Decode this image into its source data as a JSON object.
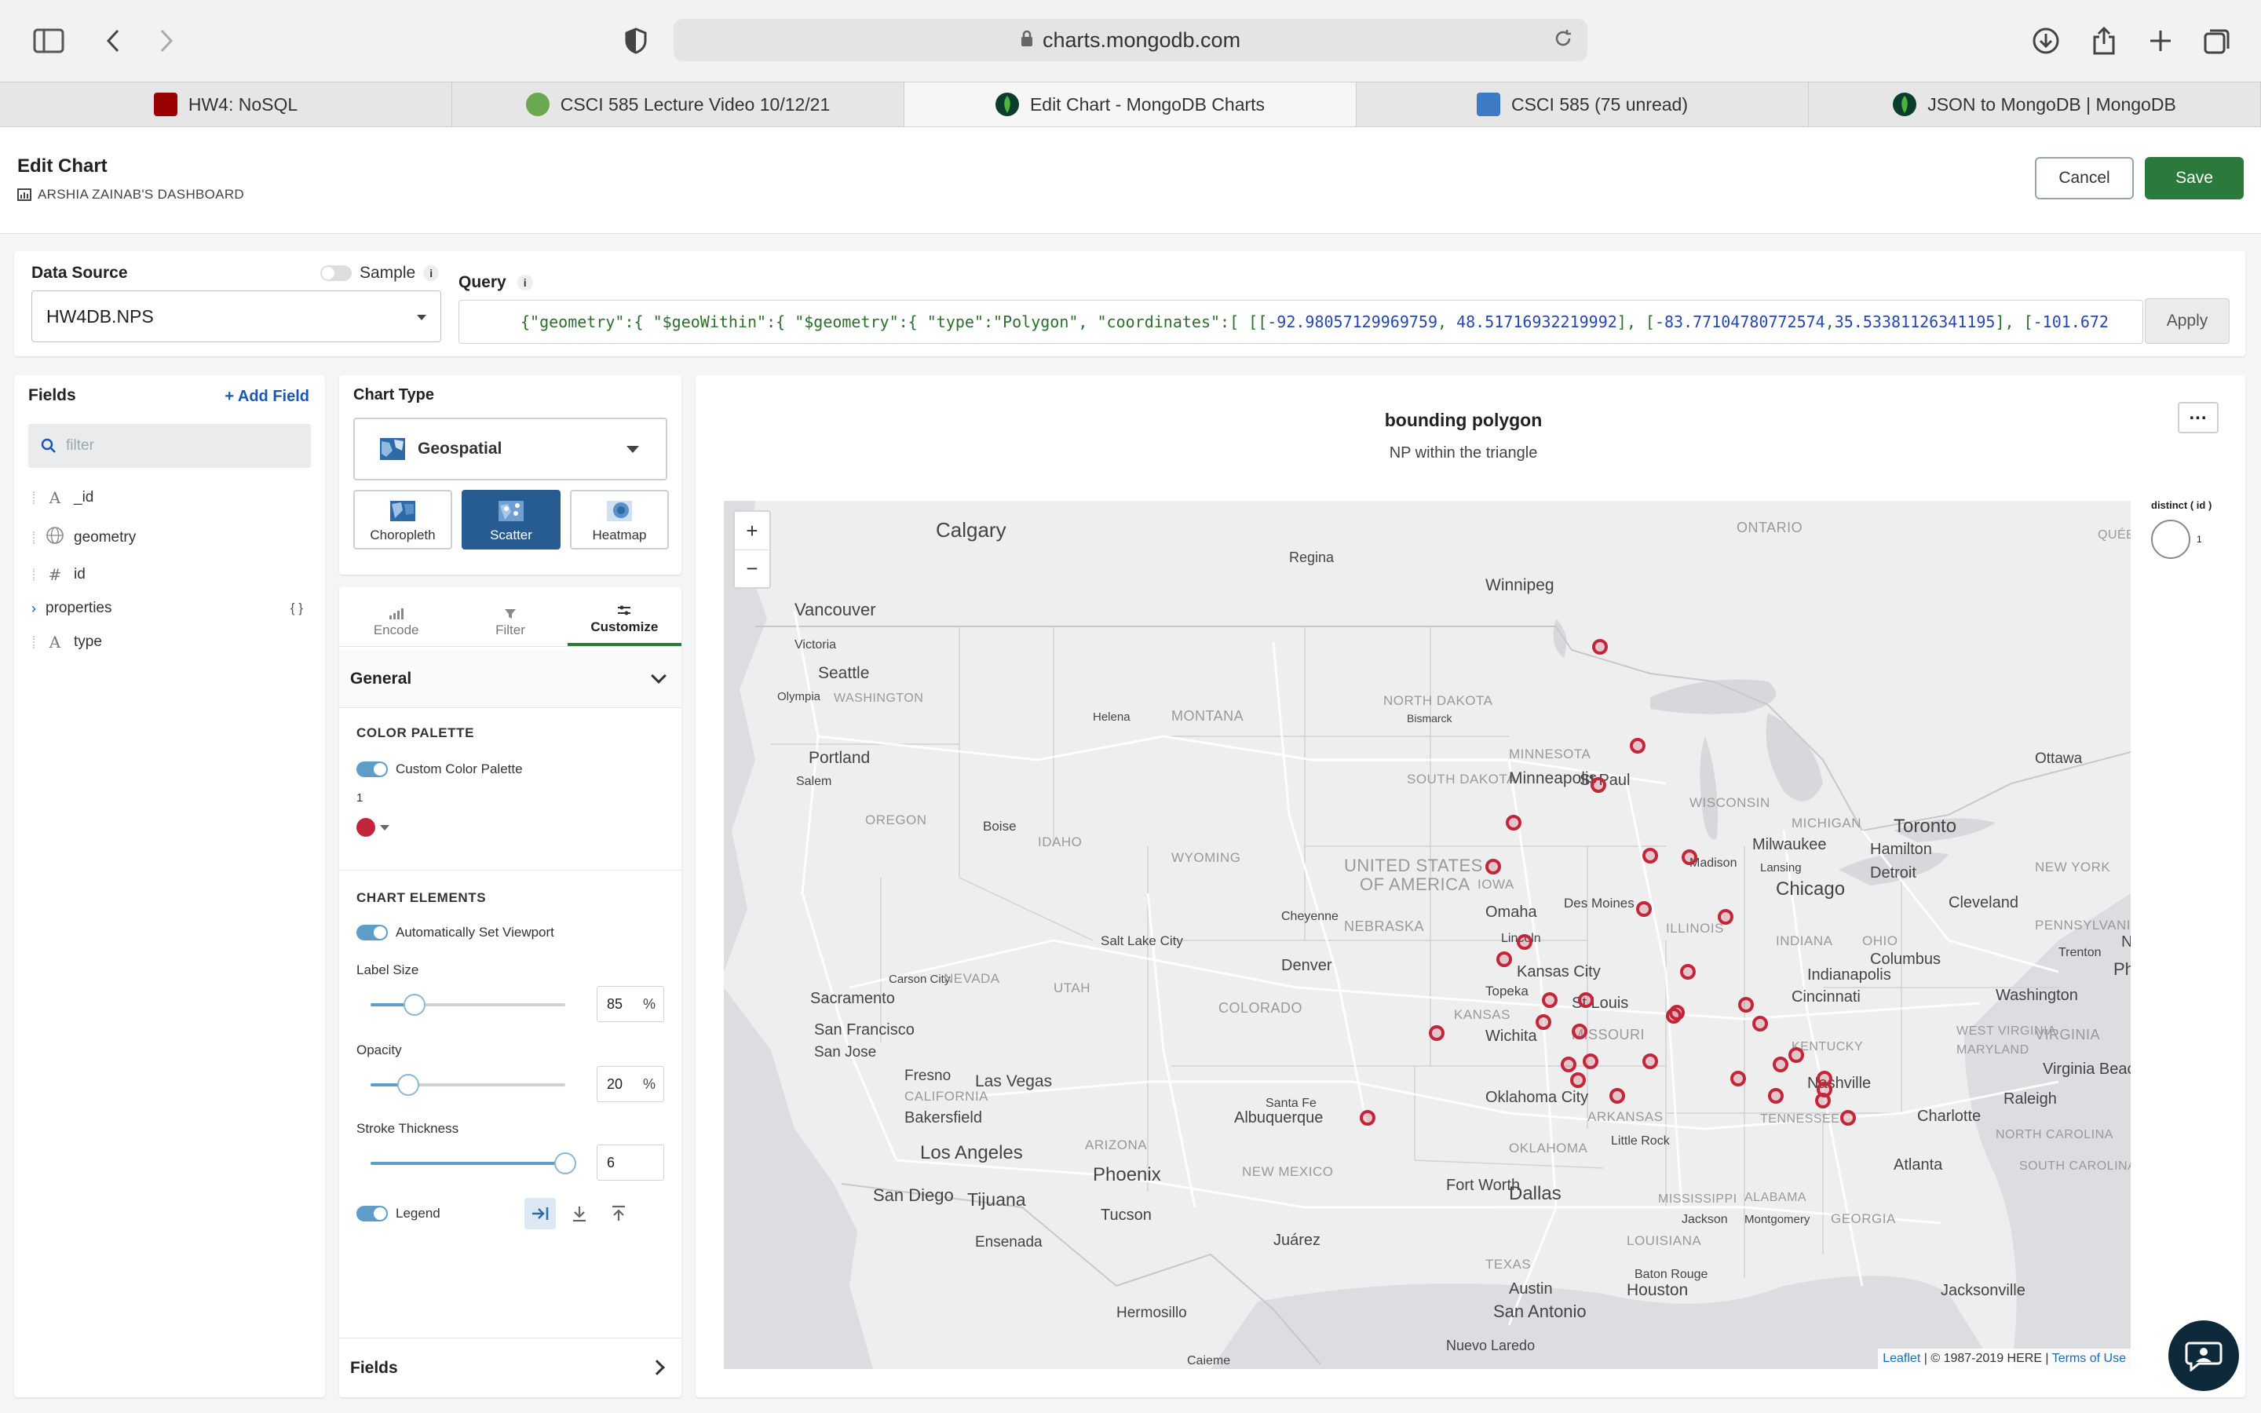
{
  "browser": {
    "url": "charts.mongodb.com",
    "tabs": [
      {
        "label": "HW4: NoSQL",
        "icon": "usc-icon"
      },
      {
        "label": "CSCI 585 Lecture Video 10/12/21",
        "icon": "video-icon"
      },
      {
        "label": "Edit Chart - MongoDB Charts",
        "icon": "mongodb-leaf-icon"
      },
      {
        "label": "CSCI 585 (75 unread)",
        "icon": "piazza-icon"
      },
      {
        "label": "JSON to MongoDB | MongoDB",
        "icon": "mongodb-leaf-icon"
      }
    ]
  },
  "header": {
    "title": "Edit Chart",
    "dashboard": "ARSHIA ZAINAB'S DASHBOARD",
    "cancel": "Cancel",
    "save": "Save"
  },
  "datasource": {
    "label": "Data Source",
    "sample_label": "Sample",
    "value": "HW4DB.NPS",
    "query_label": "Query",
    "query_text_1": "{\"geometry\":{ \"$geoWithin\":{ \"$geometry\":{ \"type\":\"Polygon\", \"coordinates\":[ [[",
    "query_num_1": "-92.98057129969759",
    "query_sep_1": ", ",
    "query_num_2": "48.51716932219992",
    "query_text_2": "], [",
    "query_num_3": "-83.77104780772574",
    "query_sep_2": ",",
    "query_num_4": "35.53381126341195",
    "query_text_3": "], [",
    "query_num_5": "-101.672",
    "apply": "Apply"
  },
  "fields": {
    "title": "Fields",
    "add": "Add Field",
    "filter_placeholder": "filter",
    "items": [
      {
        "type": "A",
        "name": "_id"
      },
      {
        "type": "geo",
        "name": "geometry"
      },
      {
        "type": "#",
        "name": "id"
      },
      {
        "type": "obj",
        "name": "properties",
        "badge": "{ }"
      },
      {
        "type": "A",
        "name": "type"
      }
    ]
  },
  "chart_type": {
    "title": "Chart Type",
    "selected": "Geospatial",
    "subtypes": [
      "Choropleth",
      "Scatter",
      "Heatmap"
    ],
    "active_subtype": "Scatter"
  },
  "customize": {
    "tabs": [
      "Encode",
      "Filter",
      "Customize"
    ],
    "active_tab": "Customize",
    "section": "General",
    "color_palette_label": "COLOR PALETTE",
    "custom_palette_label": "Custom Color Palette",
    "palette_index": "1",
    "palette_color": "#c3263a",
    "chart_elements_label": "CHART ELEMENTS",
    "auto_viewport_label": "Automatically Set Viewport",
    "label_size_label": "Label Size",
    "label_size": "85",
    "opacity_label": "Opacity",
    "opacity": "20",
    "stroke_label": "Stroke Thickness",
    "stroke": "6",
    "legend_label": "Legend",
    "pct": "%",
    "fields_footer": "Fields"
  },
  "chart": {
    "title": "bounding polygon",
    "subtitle": "NP within the triangle",
    "legend_title": "distinct ( id )",
    "legend_value": "1",
    "marker_color": "#c3263a",
    "attribution_link1": "Leaflet",
    "attribution_text": "| © 1987-2019 HERE |",
    "attribution_link2": "Terms of Use",
    "zoom_in": "+",
    "zoom_out": "−"
  },
  "map_labels": [
    {
      "t": "Calgary"
    },
    {
      "t": "Regina"
    },
    {
      "t": "Winnipeg"
    },
    {
      "t": "ONTARIO"
    },
    {
      "t": "QUÉBE"
    },
    {
      "t": "Vancouver"
    },
    {
      "t": "Victoria"
    },
    {
      "t": "Seattle"
    },
    {
      "t": "Olympia"
    },
    {
      "t": "WASHINGTON"
    },
    {
      "t": "Helena"
    },
    {
      "t": "MONTANA"
    },
    {
      "t": "NORTH DAKOTA"
    },
    {
      "t": "Bismarck"
    },
    {
      "t": "MINNESOTA"
    },
    {
      "t": "Portland"
    },
    {
      "t": "Salem"
    },
    {
      "t": "OREGON"
    },
    {
      "t": "Boise"
    },
    {
      "t": "IDAHO"
    },
    {
      "t": "SOUTH DAKOTA"
    },
    {
      "t": "Minneapolis"
    },
    {
      "t": "St Paul"
    },
    {
      "t": "WISCONSIN"
    },
    {
      "t": "MICHIGAN"
    },
    {
      "t": "Toronto"
    },
    {
      "t": "Ottawa"
    },
    {
      "t": "Hamilton"
    },
    {
      "t": "Milwaukee"
    },
    {
      "t": "Madison"
    },
    {
      "t": "Lansing"
    },
    {
      "t": "Detroit"
    },
    {
      "t": "NEW YORK"
    },
    {
      "t": "WYOMING"
    },
    {
      "t": "UNITED STATES"
    },
    {
      "t": "OF AMERICA"
    },
    {
      "t": "IOWA"
    },
    {
      "t": "Des Moines"
    },
    {
      "t": "Chicago"
    },
    {
      "t": "Cleveland"
    },
    {
      "t": "PENNSYLVANIA"
    },
    {
      "t": "NEBRASKA"
    },
    {
      "t": "Omaha"
    },
    {
      "t": "Cheyenne"
    },
    {
      "t": "Lincoln"
    },
    {
      "t": "INDIANA"
    },
    {
      "t": "OHIO"
    },
    {
      "t": "Columbus"
    },
    {
      "t": "Trenton"
    },
    {
      "t": "Phila"
    },
    {
      "t": "Salt Lake City"
    },
    {
      "t": "Denver"
    },
    {
      "t": "Kansas City"
    },
    {
      "t": "ILLINOIS"
    },
    {
      "t": "Indianapolis"
    },
    {
      "t": "Ne"
    },
    {
      "t": "Carson City"
    },
    {
      "t": "NEVADA"
    },
    {
      "t": "Sacramento"
    },
    {
      "t": "UTAH"
    },
    {
      "t": "COLORADO"
    },
    {
      "t": "Topeka"
    },
    {
      "t": "St Louis"
    },
    {
      "t": "Cincinnati"
    },
    {
      "t": "Washington"
    },
    {
      "t": "San Francisco"
    },
    {
      "t": "San Jose"
    },
    {
      "t": "KANSAS"
    },
    {
      "t": "Wichita"
    },
    {
      "t": "MISSOURI"
    },
    {
      "t": "KENTUCKY"
    },
    {
      "t": "WEST VIRGINIA"
    },
    {
      "t": "MARYLAND"
    },
    {
      "t": "VIRGINIA"
    },
    {
      "t": "Virginia Beach"
    },
    {
      "t": "Fresno"
    },
    {
      "t": "CALIFORNIA"
    },
    {
      "t": "Las Vegas"
    },
    {
      "t": "Santa Fe"
    },
    {
      "t": "Oklahoma City"
    },
    {
      "t": "Nashville"
    },
    {
      "t": "Raleigh"
    },
    {
      "t": "Bakersfield"
    },
    {
      "t": "Albuquerque"
    },
    {
      "t": "ARKANSAS"
    },
    {
      "t": "TENNESSEE"
    },
    {
      "t": "Charlotte"
    },
    {
      "t": "NORTH CAROLINA"
    },
    {
      "t": "Los Angeles"
    },
    {
      "t": "ARIZONA"
    },
    {
      "t": "OKLAHOMA"
    },
    {
      "t": "Little Rock"
    },
    {
      "t": "Phoenix"
    },
    {
      "t": "NEW MEXICO"
    },
    {
      "t": "Atlanta"
    },
    {
      "t": "SOUTH CAROLINA"
    },
    {
      "t": "San Diego"
    },
    {
      "t": "Tijuana"
    },
    {
      "t": "Fort Worth"
    },
    {
      "t": "Dallas"
    },
    {
      "t": "MISSISSIPPI"
    },
    {
      "t": "ALABAMA"
    },
    {
      "t": "Tucson"
    },
    {
      "t": "Jackson"
    },
    {
      "t": "Montgomery"
    },
    {
      "t": "GEORGIA"
    },
    {
      "t": "Ensenada"
    },
    {
      "t": "Juárez"
    },
    {
      "t": "LOUISIANA"
    },
    {
      "t": "TEXAS"
    },
    {
      "t": "Baton Rouge"
    },
    {
      "t": "Austin"
    },
    {
      "t": "Houston"
    },
    {
      "t": "Jacksonville"
    },
    {
      "t": "Hermosillo"
    },
    {
      "t": "San Antonio"
    },
    {
      "t": "Nuevo Laredo"
    },
    {
      "t": "Caieme"
    }
  ]
}
